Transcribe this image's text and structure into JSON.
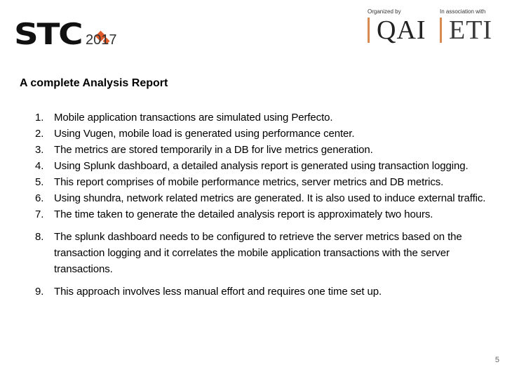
{
  "header": {
    "logo": {
      "brand": "STC",
      "year": "2017",
      "accent_color": "#e05a2a"
    },
    "organizer": {
      "label": "Organized by",
      "name": "QAI",
      "bar_color": "#d98a50"
    },
    "associate": {
      "label": "In association with",
      "name": "ETI",
      "bar_color": "#d98a50"
    }
  },
  "slide": {
    "title": "A complete Analysis Report",
    "items": [
      {
        "num": "1.",
        "text": "Mobile application transactions are simulated using Perfecto."
      },
      {
        "num": "2.",
        "text": "Using Vugen, mobile load is generated using performance center."
      },
      {
        "num": "3.",
        "text": "The metrics are stored temporarily in a DB for live metrics generation."
      },
      {
        "num": "4.",
        "text": "Using Splunk dashboard, a detailed analysis report is generated using transaction logging."
      },
      {
        "num": "5.",
        "text": "This report comprises of mobile performance metrics, server metrics and DB metrics."
      },
      {
        "num": "6.",
        "text": "Using shundra, network related metrics are generated. It is also used to induce external traffic."
      },
      {
        "num": "7.",
        "text": "The time taken to generate the detailed analysis report is approximately two hours."
      },
      {
        "num": "8.",
        "text": "The splunk dashboard needs to be configured to retrieve the server metrics based on the transaction logging and it correlates the mobile application transactions with the server transactions."
      },
      {
        "num": "9.",
        "text": "This approach involves less manual effort and requires one time set up."
      }
    ],
    "page_number": "5"
  }
}
